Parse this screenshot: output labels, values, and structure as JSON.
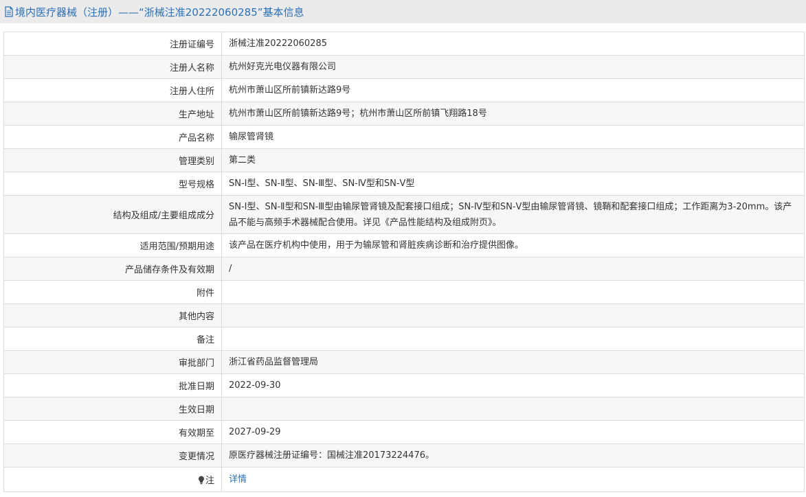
{
  "header": {
    "title": "境内医疗器械（注册）——“浙械注准20222060285”基本信息",
    "icon": "document-icon"
  },
  "rows": [
    {
      "label": "注册证编号",
      "value": "浙械注准20222060285"
    },
    {
      "label": "注册人名称",
      "value": "杭州好克光电仪器有限公司"
    },
    {
      "label": "注册人住所",
      "value": "杭州市萧山区所前镇新达路9号"
    },
    {
      "label": "生产地址",
      "value": "杭州市萧山区所前镇新达路9号；杭州市萧山区所前镇飞翔路18号"
    },
    {
      "label": "产品名称",
      "value": "输尿管肾镜"
    },
    {
      "label": "管理类别",
      "value": "第二类"
    },
    {
      "label": "型号规格",
      "value": "SN-Ⅰ型、SN-Ⅱ型、SN-Ⅲ型、SN-Ⅳ型和SN-Ⅴ型"
    },
    {
      "label": "结构及组成/主要组成成分",
      "value": "SN-Ⅰ型、SN-Ⅱ型和SN-Ⅲ型由输尿管肾镜及配套接口组成；SN-Ⅳ型和SN-Ⅴ型由输尿管肾镜、镜鞘和配套接口组成；工作距离为3-20mm。该产品不能与高频手术器械配合使用。详见《产品性能结构及组成附页》。"
    },
    {
      "label": "适用范围/预期用途",
      "value": "该产品在医疗机构中使用，用于为输尿管和肾脏疾病诊断和治疗提供图像。"
    },
    {
      "label": "产品储存条件及有效期",
      "value": "/"
    },
    {
      "label": "附件",
      "value": ""
    },
    {
      "label": "其他内容",
      "value": ""
    },
    {
      "label": "备注",
      "value": ""
    },
    {
      "label": "审批部门",
      "value": "浙江省药品监督管理局"
    },
    {
      "label": "批准日期",
      "value": "2022-09-30"
    },
    {
      "label": "生效日期",
      "value": ""
    },
    {
      "label": "有效期至",
      "value": "2027-09-29"
    },
    {
      "label": "变更情况",
      "value": "原医疗器械注册证编号：国械注准20173224476。"
    }
  ],
  "note_row": {
    "label": "注",
    "icon": "lightbulb-icon",
    "link_text": "详情"
  },
  "colors": {
    "accent": "#2b6fb6",
    "header_bg": "#ebebeb",
    "border": "#dcdcdc",
    "alt_row": "#f6f7f9"
  }
}
